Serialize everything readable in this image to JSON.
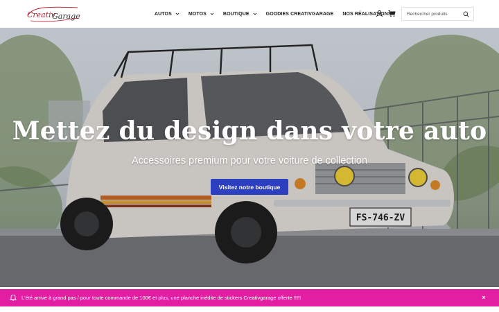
{
  "brand": {
    "logo_text": "CreativGarage",
    "logo_color": "#b8202f"
  },
  "nav": {
    "items": [
      {
        "label": "AUTOS",
        "has_dropdown": true
      },
      {
        "label": "MOTOS",
        "has_dropdown": true
      },
      {
        "label": "BOUTIQUE",
        "has_dropdown": true
      },
      {
        "label": "GOODIES CREATIVGARAGE",
        "has_dropdown": false
      },
      {
        "label": "NOS RÉALISATIONS",
        "has_dropdown": false
      }
    ]
  },
  "header_icons": {
    "account": "user-icon",
    "cart": "cart-icon",
    "search": "search-icon"
  },
  "search": {
    "placeholder": "Rechercher produits",
    "value": ""
  },
  "hero": {
    "title": "Mettez du design dans votre auto",
    "subtitle": "Accessoires premium pour votre voiture de collection",
    "cta_label": "Visitez notre boutique",
    "plate_text": "FS-746-ZV"
  },
  "promo": {
    "text": "L'été arrive à grand pas / pour toute commande de 100€ et plus, une planche inédite de stickers Creativgarage offerte !!!!!",
    "close_label": "×",
    "icon": "bell-icon"
  },
  "colors": {
    "accent_button": "#2b3fc0",
    "promo_bar": "#e21fa3",
    "text_dark": "#222222"
  }
}
